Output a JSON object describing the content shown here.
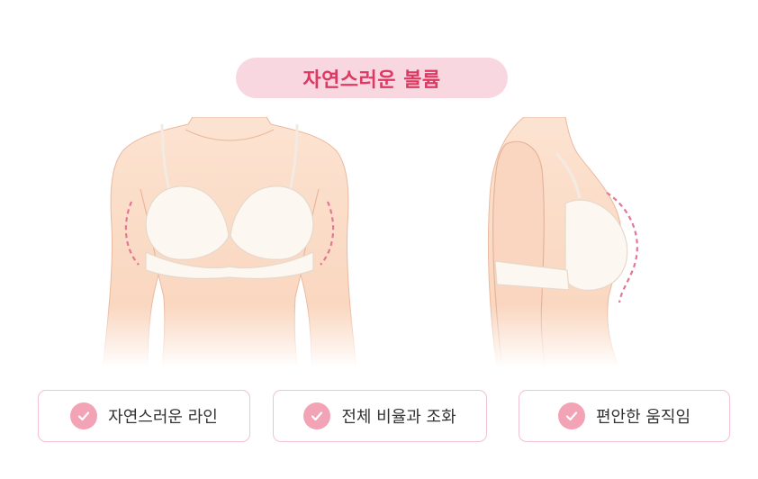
{
  "title": "자연스러운 볼륨",
  "features": [
    {
      "label": "자연스러운 라인",
      "icon": "check-circle-icon"
    },
    {
      "label": "전체 비율과 조화",
      "icon": "check-circle-icon"
    },
    {
      "label": "편안한 움직임",
      "icon": "check-circle-icon"
    }
  ],
  "colors": {
    "accent": "#dc3a63",
    "pill_bg": "#f8d7e1",
    "badge_border": "#f1c2cf",
    "check_bg": "#f3a3b6",
    "skin": "#fbdcc6",
    "bra": "#fcf7f1",
    "dash": "#e07896"
  }
}
